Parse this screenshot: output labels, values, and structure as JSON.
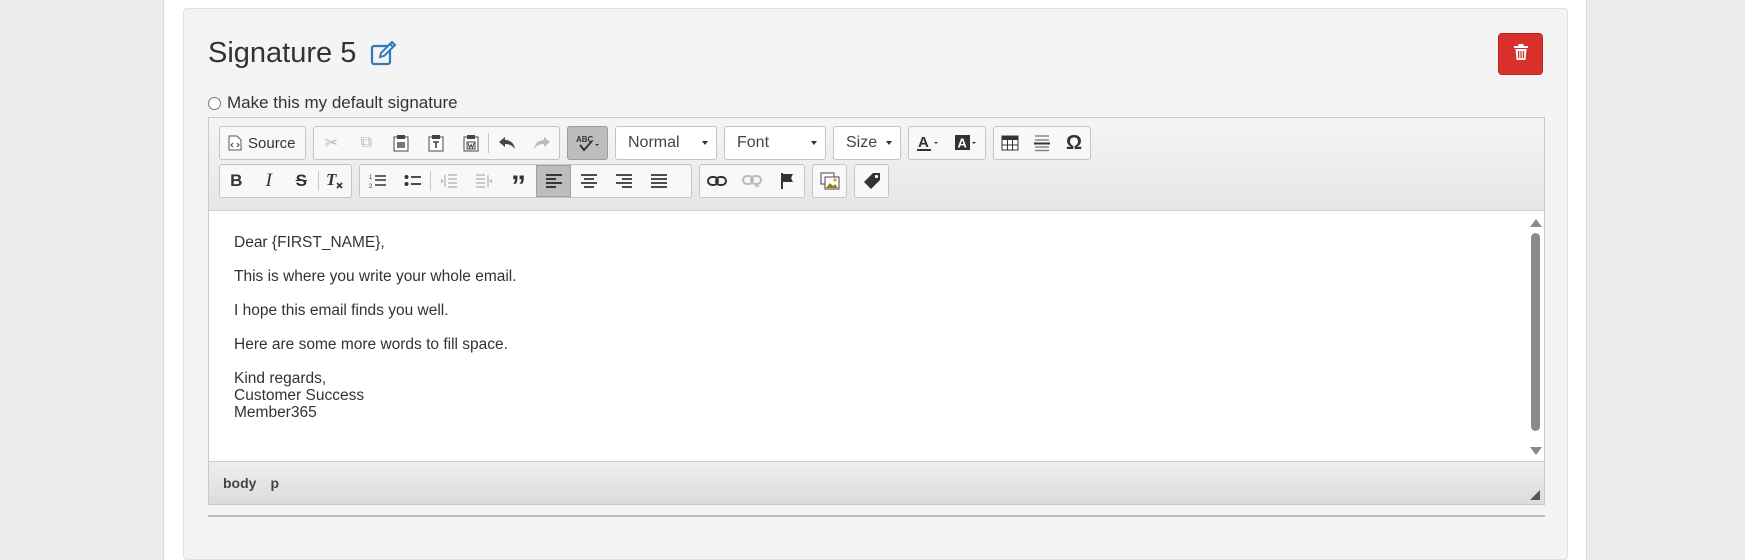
{
  "signature": {
    "title": "Signature 5",
    "default_label": "Make this my default signature"
  },
  "toolbar": {
    "source_label": "Source",
    "format_value": "Normal",
    "font_value": "Font",
    "size_value": "Size"
  },
  "editor_content": {
    "line1": "Dear {FIRST_NAME},",
    "line2": "This is where you write your whole email.",
    "line3": "I hope this email finds you well.",
    "line4": "Here are some more words to fill space.",
    "line5": "Kind regards,",
    "line6": "Customer Success",
    "line7": "Member365"
  },
  "statusbar": {
    "path1": "body",
    "path2": "p"
  },
  "colors": {
    "delete": "#d9302c",
    "accent": "#337ab7"
  }
}
